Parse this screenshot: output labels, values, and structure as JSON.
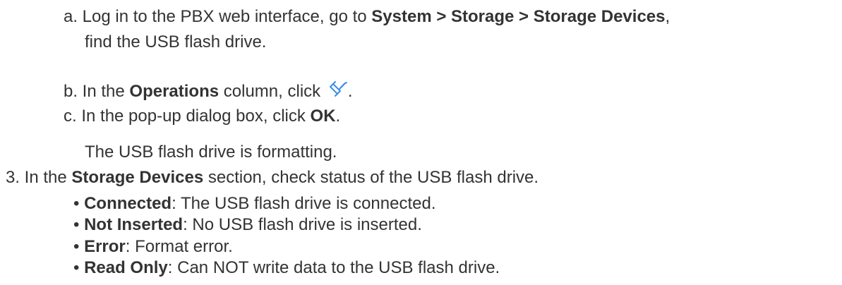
{
  "steps": {
    "a": {
      "prefix": "a. Log in to the PBX web interface, go to ",
      "path": "System > Storage > Storage Devices",
      "suffix": ",",
      "cont": "find the USB flash drive."
    },
    "b": {
      "prefix": "b. In the ",
      "bold": "Operations",
      "mid": " column, click",
      "suffix": ".",
      "icon": "format-brush-icon"
    },
    "c": {
      "prefix": "c. In the pop-up dialog box, click ",
      "bold": "OK",
      "suffix": "."
    },
    "result": "The USB flash drive is formatting.",
    "step3": {
      "prefix": "3. In the ",
      "bold": "Storage Devices",
      "suffix": " section, check status of the USB flash drive."
    }
  },
  "statuses": [
    {
      "bullet": "• ",
      "term": "Connected",
      "desc": ": The USB flash drive is connected."
    },
    {
      "bullet": "• ",
      "term": "Not Inserted",
      "desc": ": No USB flash drive is inserted."
    },
    {
      "bullet": "• ",
      "term": "Error",
      "desc": ": Format error."
    },
    {
      "bullet": "• ",
      "term": "Read Only",
      "desc": ": Can NOT write data to the USB flash drive."
    }
  ],
  "colors": {
    "text": "#333333",
    "icon": "#3a8ee6"
  }
}
